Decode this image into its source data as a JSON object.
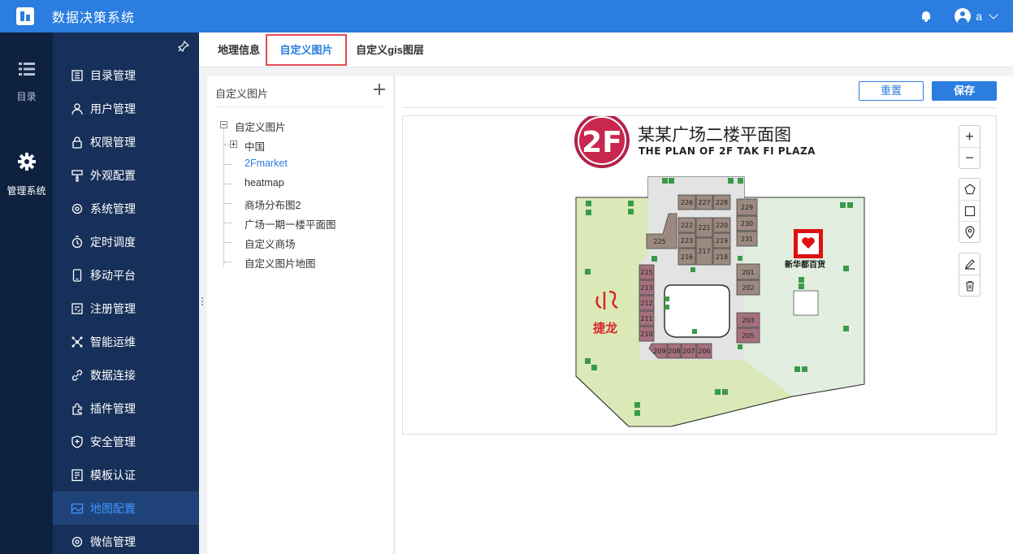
{
  "header": {
    "app_title": "数据决策系统",
    "username": "a"
  },
  "rail": {
    "items": [
      {
        "label": "目录",
        "icon": "list-icon"
      },
      {
        "label": "管理系统",
        "icon": "gear-icon"
      }
    ]
  },
  "sidebar": {
    "items": [
      {
        "label": "目录管理",
        "icon": "catalog-icon"
      },
      {
        "label": "用户管理",
        "icon": "user-icon"
      },
      {
        "label": "权限管理",
        "icon": "lock-icon"
      },
      {
        "label": "外观配置",
        "icon": "brush-icon"
      },
      {
        "label": "系统管理",
        "icon": "gear-icon"
      },
      {
        "label": "定时调度",
        "icon": "timer-icon"
      },
      {
        "label": "移动平台",
        "icon": "mobile-icon"
      },
      {
        "label": "注册管理",
        "icon": "register-icon"
      },
      {
        "label": "智能运维",
        "icon": "network-icon"
      },
      {
        "label": "数据连接",
        "icon": "link-icon"
      },
      {
        "label": "插件管理",
        "icon": "plugin-icon"
      },
      {
        "label": "安全管理",
        "icon": "shield-icon"
      },
      {
        "label": "模板认证",
        "icon": "template-icon"
      },
      {
        "label": "地图配置",
        "icon": "map-icon",
        "active": true
      },
      {
        "label": "微信管理",
        "icon": "wechat-icon"
      }
    ]
  },
  "tabs": [
    {
      "label": "地理信息"
    },
    {
      "label": "自定义图片",
      "active": true
    },
    {
      "label": "自定义gis图层"
    }
  ],
  "tree": {
    "title": "自定义图片",
    "root": "自定义图片",
    "children": [
      "中国",
      "2Fmarket",
      "heatmap",
      "商场分布图2",
      "广场一期一楼平面图",
      "自定义商场",
      "自定义图片地图"
    ],
    "selected": "2Fmarket"
  },
  "toolbar": {
    "reset_label": "重置",
    "save_label": "保存"
  },
  "floorplan": {
    "badge": "2F",
    "title_cn": "某某广场二楼平面图",
    "title_en": "THE PLAN OF 2F TAK FI PLAZA",
    "store_name": "新华都百货",
    "brand_name": "捷龙",
    "units": [
      "226",
      "227",
      "228",
      "229",
      "230",
      "231",
      "225",
      "222",
      "221",
      "220",
      "223",
      "219",
      "216",
      "217",
      "218",
      "201",
      "202",
      "215",
      "213",
      "212",
      "211",
      "210",
      "209",
      "208",
      "207",
      "206",
      "203",
      "205"
    ]
  },
  "colors": {
    "header_blue": "#2b7de0",
    "sidebar_dark": "#17305a",
    "rail_dark": "#0e2240",
    "active_tab_border": "#e04b54",
    "shop_brown": "#9c8a80",
    "shop_purple": "#a5707e",
    "area_green": "#dbe9b8",
    "area_mint": "#e2efe0"
  }
}
